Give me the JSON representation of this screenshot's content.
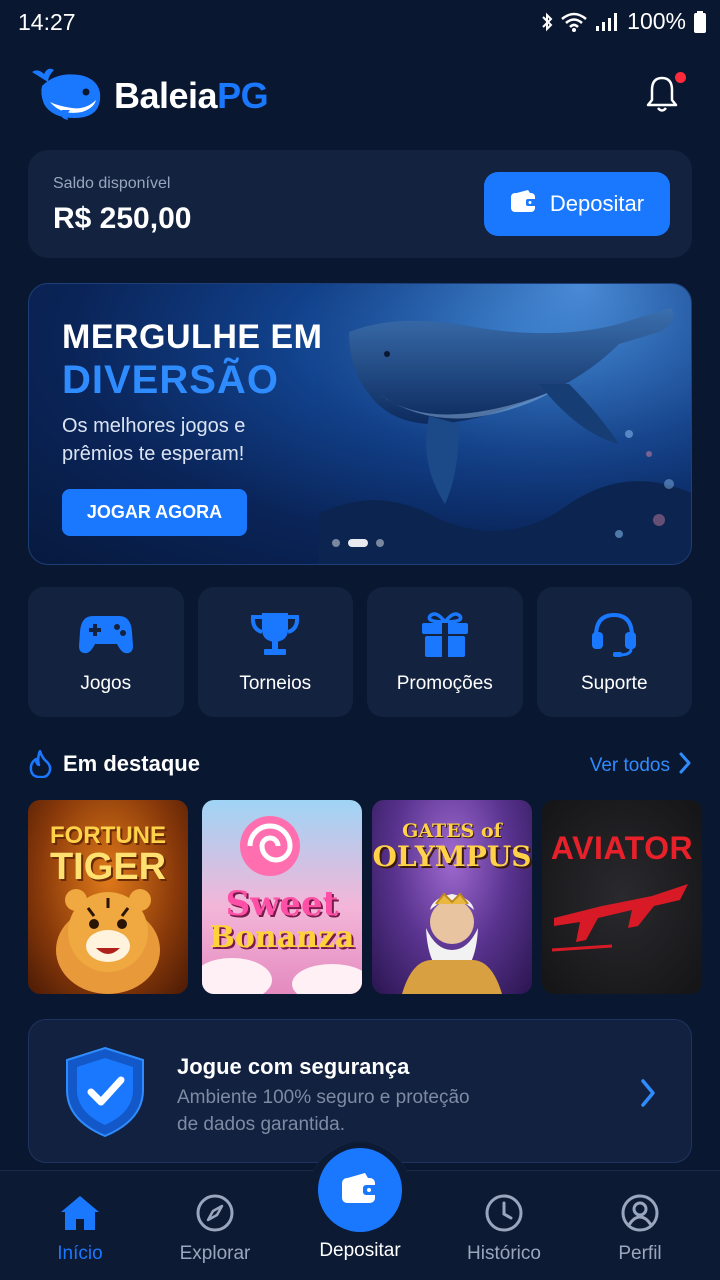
{
  "status_bar": {
    "time": "14:27",
    "battery": "100%"
  },
  "header": {
    "brand_part1": "Baleia",
    "brand_part2": "PG"
  },
  "balance": {
    "label": "Saldo disponível",
    "value": "R$ 250,00",
    "deposit_label": "Depositar"
  },
  "hero": {
    "title_line1": "MERGULHE EM",
    "title_line2": "DIVERSÃO",
    "subtitle": "Os melhores jogos e prêmios te esperam!",
    "button_label": "JOGAR AGORA",
    "active_slide": 2,
    "slide_count": 3
  },
  "quick_actions": [
    {
      "label": "Jogos",
      "icon": "gamepad-icon"
    },
    {
      "label": "Torneios",
      "icon": "trophy-icon"
    },
    {
      "label": "Promoções",
      "icon": "gift-icon"
    },
    {
      "label": "Suporte",
      "icon": "headset-icon"
    }
  ],
  "featured": {
    "title": "Em destaque",
    "see_all": "Ver todos",
    "games": [
      {
        "line1": "FORTUNE",
        "line2": "TIGER"
      },
      {
        "line1": "Sweet",
        "line2": "Bonanza"
      },
      {
        "line1": "GATES of",
        "line2": "OLYMPUS"
      },
      {
        "line1": "AVIATOR",
        "line2": ""
      }
    ]
  },
  "security": {
    "title": "Jogue com segurança",
    "description": "Ambiente 100% seguro e proteção de dados garantida."
  },
  "bottom_nav": {
    "items": [
      {
        "label": "Início",
        "icon": "home-icon",
        "active": true
      },
      {
        "label": "Explorar",
        "icon": "compass-icon",
        "active": false
      },
      {
        "label": "Depositar",
        "icon": "wallet-icon",
        "active": false
      },
      {
        "label": "Histórico",
        "icon": "clock-icon",
        "active": false
      },
      {
        "label": "Perfil",
        "icon": "user-icon",
        "active": false
      }
    ]
  },
  "colors": {
    "accent": "#1a78ff",
    "background": "#0a1730",
    "card": "#13223f",
    "notification": "#ff2b3a"
  }
}
